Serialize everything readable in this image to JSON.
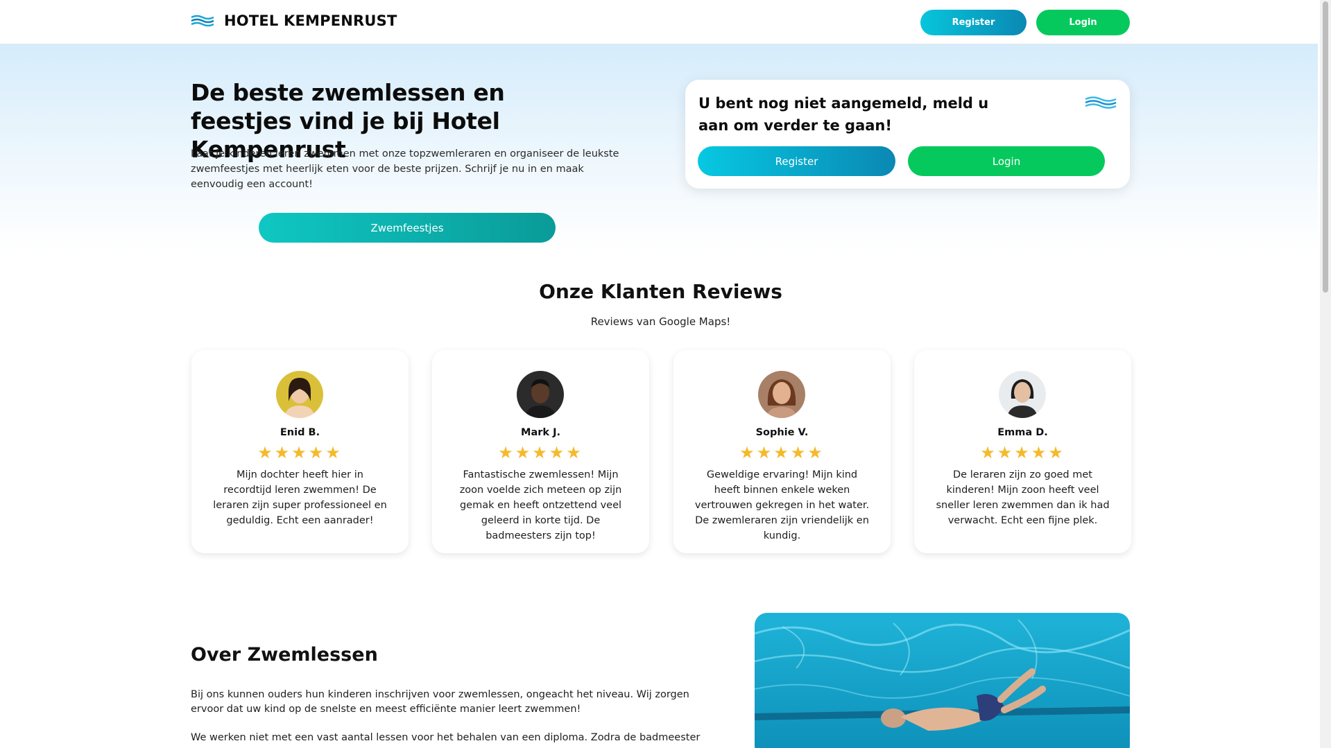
{
  "header": {
    "brand": "HOTEL KEMPENRUST",
    "register_label": "Register",
    "login_label": "Login"
  },
  "hero": {
    "title": "De beste zwemlessen en feestjes vind je bij Hotel Kempenrust",
    "text": "Laat je kinderen leren zwemmen met onze topzwemleraren en organiseer de leukste zwemfeestjes met heerlijk eten voor de beste prijzen. Schrijf je nu in en maak eenvoudig een account!",
    "party_button": "Zwemfeestjes"
  },
  "login_card": {
    "message": "U bent nog niet aangemeld, meld u aan om verder te gaan!",
    "register_label": "Register",
    "login_label": "Login"
  },
  "reviews": {
    "title": "Onze Klanten Reviews",
    "subtitle": "Reviews van Google Maps!",
    "items": [
      {
        "name": "Enid B.",
        "stars": 5,
        "text": "Mijn dochter heeft hier in recordtijd leren zwemmen! De leraren zijn super professioneel en geduldig. Echt een aanrader!"
      },
      {
        "name": "Mark J.",
        "stars": 5,
        "text": "Fantastische zwemlessen! Mijn zoon voelde zich meteen op zijn gemak en heeft ontzettend veel geleerd in korte tijd. De badmeesters zijn top!"
      },
      {
        "name": "Sophie V.",
        "stars": 5,
        "text": "Geweldige ervaring! Mijn kind heeft binnen enkele weken vertrouwen gekregen in het water. De zwemleraren zijn vriendelijk en kundig."
      },
      {
        "name": "Emma D.",
        "stars": 5,
        "text": "De leraren zijn zo goed met kinderen! Mijn zoon heeft veel sneller leren zwemmen dan ik had verwacht. Echt een fijne plek."
      }
    ]
  },
  "about": {
    "title": "Over Zwemlessen",
    "paragraph1": "Bij ons kunnen ouders hun kinderen inschrijven voor zwemlessen, ongeacht het niveau. Wij zorgen ervoor dat uw kind op de snelste en meest efficiënte manier leert zwemmen!",
    "paragraph2": "We werken niet met een vast aantal lessen voor het behalen van een diploma. Zodra de badmeester"
  },
  "colors": {
    "accent_cyan": "#07c6dc",
    "accent_blue": "#0a88b3",
    "login_green": "#06c95d",
    "teal_button": "#0fc7c2",
    "star": "#f5b92b"
  },
  "icons": {
    "logo": "waves-icon",
    "star": "star-icon"
  }
}
